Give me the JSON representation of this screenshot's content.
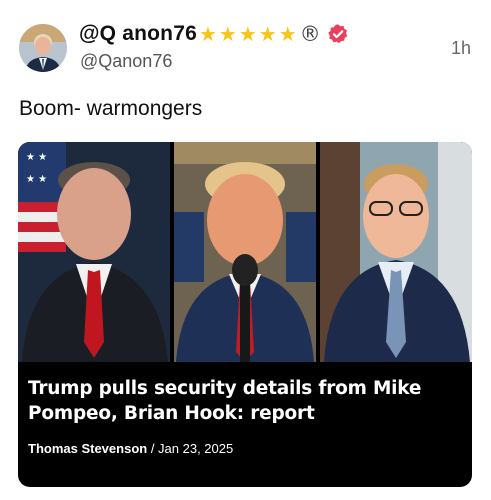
{
  "post": {
    "display_name": "@Q anon76",
    "name_suffix_icons": [
      "star-emoji",
      "star-emoji",
      "star-emoji",
      "star-emoji",
      "star-emoji",
      "registered-icon",
      "verified-badge-icon"
    ],
    "stars": "★",
    "registered": "®",
    "handle": "@Qanon76",
    "timestamp": "1h",
    "text": "Boom- warmongers"
  },
  "link_card": {
    "headline": "Trump pulls security details from Mike Pompeo, Brian Hook: report",
    "author": "Thomas Stevenson",
    "separator": " / ",
    "date": "Jan 23, 2025"
  },
  "colors": {
    "star": "#f5c518",
    "verified_badge": "#e8405e",
    "card_background": "#000000"
  }
}
